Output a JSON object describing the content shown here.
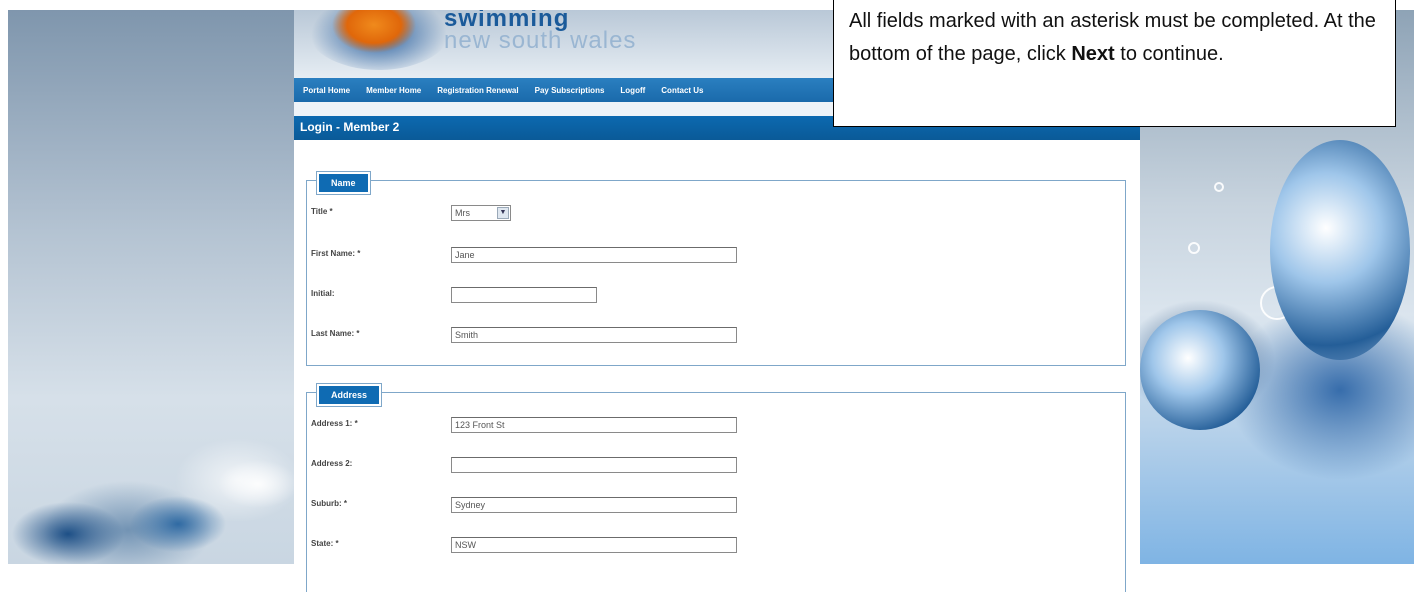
{
  "logo": {
    "line1": "swimming",
    "line2": "new south wales"
  },
  "nav": {
    "items": [
      "Portal Home",
      "Member Home",
      "Registration Renewal",
      "Pay Subscriptions",
      "Logoff",
      "Contact Us"
    ]
  },
  "page_title": "Login - Member 2",
  "name_section": {
    "legend": "Name",
    "title_label": "Title *",
    "title_value": "Mrs",
    "first_name_label": "First Name: *",
    "first_name_value": "Jane",
    "initial_label": "Initial:",
    "initial_value": "",
    "last_name_label": "Last Name: *",
    "last_name_value": "Smith"
  },
  "address_section": {
    "legend": "Address",
    "address1_label": "Address 1: *",
    "address1_value": "123 Front St",
    "address2_label": "Address 2:",
    "address2_value": "",
    "suburb_label": "Suburb: *",
    "suburb_value": "Sydney",
    "state_label": "State: *",
    "state_value": "NSW"
  },
  "callout": {
    "text_before": "All fields marked with an asterisk must be completed.  At the bottom of the page, click ",
    "bold_word": "Next",
    "text_after": " to continue."
  }
}
